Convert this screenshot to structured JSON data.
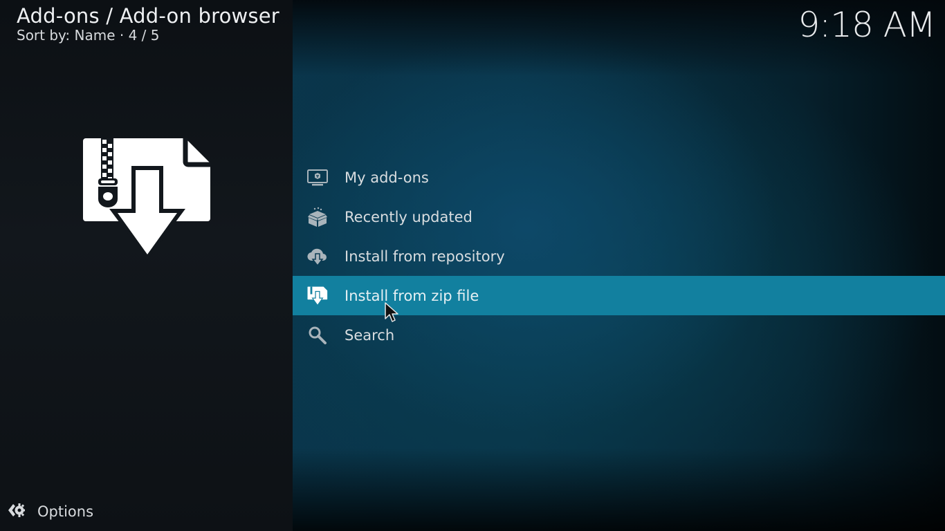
{
  "header": {
    "title": "Add-ons / Add-on browser",
    "subtitle": "Sort by: Name  ·  4 / 5"
  },
  "clock": {
    "time": "9:18 AM"
  },
  "preview": {
    "icon": "zip-file-download-icon"
  },
  "menu": {
    "selected_index": 3,
    "items": [
      {
        "label": "My add-ons",
        "icon": "monitor-addon-icon"
      },
      {
        "label": "Recently updated",
        "icon": "open-box-icon"
      },
      {
        "label": "Install from repository",
        "icon": "cloud-download-icon"
      },
      {
        "label": "Install from zip file",
        "icon": "zip-file-download-icon"
      },
      {
        "label": "Search",
        "icon": "search-icon"
      }
    ]
  },
  "options": {
    "label": "Options",
    "icon": "options-gear-icon"
  },
  "colors": {
    "highlight": "#12809f",
    "background_accent": "#0a3a52",
    "left_panel": "#12171c",
    "text": "#e6e8ea"
  }
}
